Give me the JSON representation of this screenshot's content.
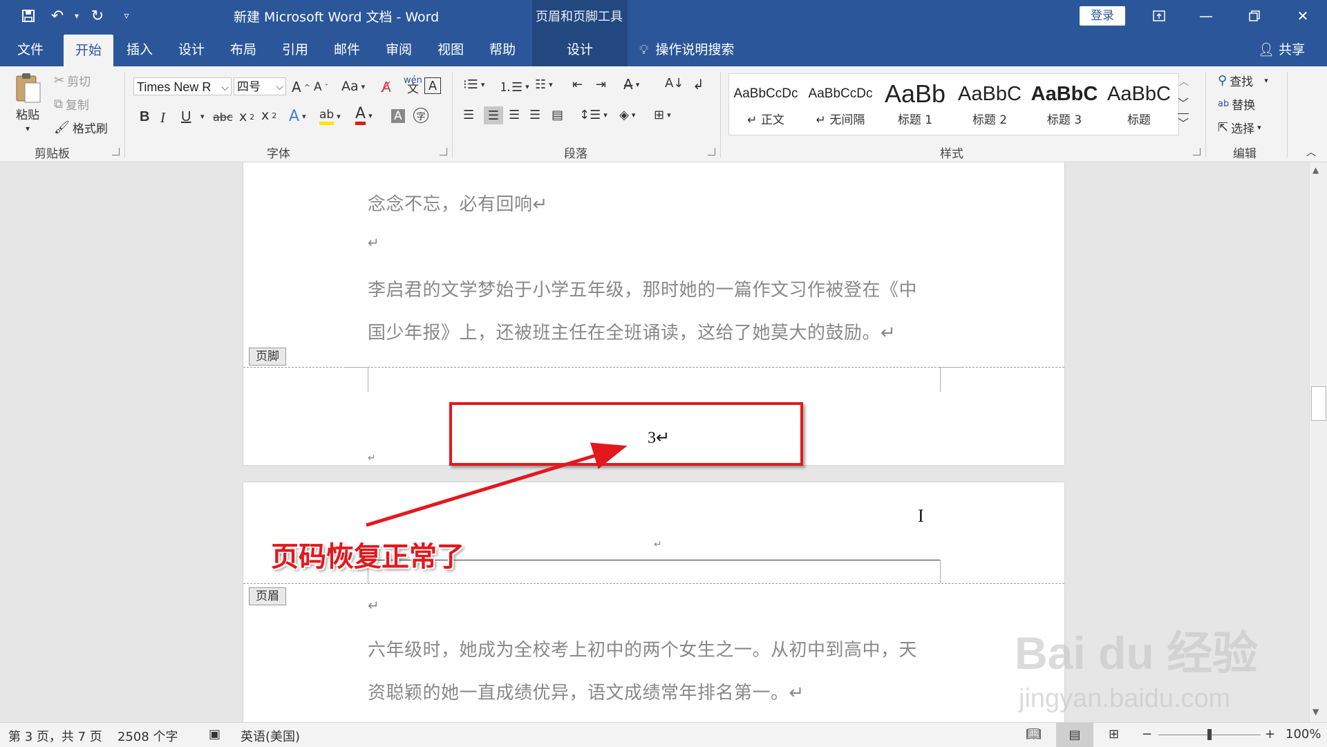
{
  "titlebar": {
    "doc_title": "新建 Microsoft Word 文档  -  Word",
    "context_tools": "页眉和页脚工具",
    "login": "登录"
  },
  "tabs": [
    {
      "label": "文件"
    },
    {
      "label": "开始"
    },
    {
      "label": "插入"
    },
    {
      "label": "设计"
    },
    {
      "label": "布局"
    },
    {
      "label": "引用"
    },
    {
      "label": "邮件"
    },
    {
      "label": "审阅"
    },
    {
      "label": "视图"
    },
    {
      "label": "帮助"
    },
    {
      "label": "设计"
    }
  ],
  "tell_me": "操作说明搜索",
  "share": "共享",
  "clipboard": {
    "paste": "粘贴",
    "cut": "剪切",
    "copy": "复制",
    "format_painter": "格式刷",
    "group": "剪贴板"
  },
  "font": {
    "name": "Times New R",
    "size": "四号",
    "group": "字体"
  },
  "paragraph": {
    "group": "段落"
  },
  "styles": {
    "group": "样式",
    "items": [
      {
        "sample": "AaBbCcDc",
        "name": "↵ 正文"
      },
      {
        "sample": "AaBbCcDc",
        "name": "↵ 无间隔"
      },
      {
        "sample": "AaBb",
        "name": "标题 1"
      },
      {
        "sample": "AaBbC",
        "name": "标题 2"
      },
      {
        "sample": "AaBbC",
        "name": "标题 3"
      },
      {
        "sample": "AaBbC",
        "name": "标题"
      }
    ]
  },
  "editing": {
    "find": "查找",
    "replace": "替换",
    "select": "选择",
    "group": "编辑"
  },
  "document": {
    "page1_para1": "念念不忘，必有回响↵",
    "page1_empty": "↵",
    "page1_para2_l1": "李启君的文学梦始于小学五年级，那时她的一篇作文习作被登在《中",
    "page1_para2_l2": "国少年报》上，还被班主任在全班诵读，这给了她莫大的鼓励。↵",
    "footer_label": "页脚",
    "page_number": "3↵",
    "footer_mark": "↵",
    "header_mark": "↵",
    "header_label": "页眉",
    "page2_empty": "↵",
    "page2_para_l1": "六年级时，她成为全校考上初中的两个女生之一。从初中到高中，天",
    "page2_para_l2": "资聪颖的她一直成绩优异，语文成绩常年排名第一。↵"
  },
  "annotation": {
    "text": "页码恢复正常了",
    "color": "#e3181d"
  },
  "watermark": {
    "brand": "Bai du 经验",
    "url": "jingyan.baidu.com"
  },
  "statusbar": {
    "page_info": "第 3 页，共 7 页",
    "word_count": "2508 个字",
    "language": "英语(美国)",
    "zoom": "100%",
    "zoom_value": 1.0
  },
  "colors": {
    "accent": "#2b579a",
    "annotation": "#e3181d"
  }
}
